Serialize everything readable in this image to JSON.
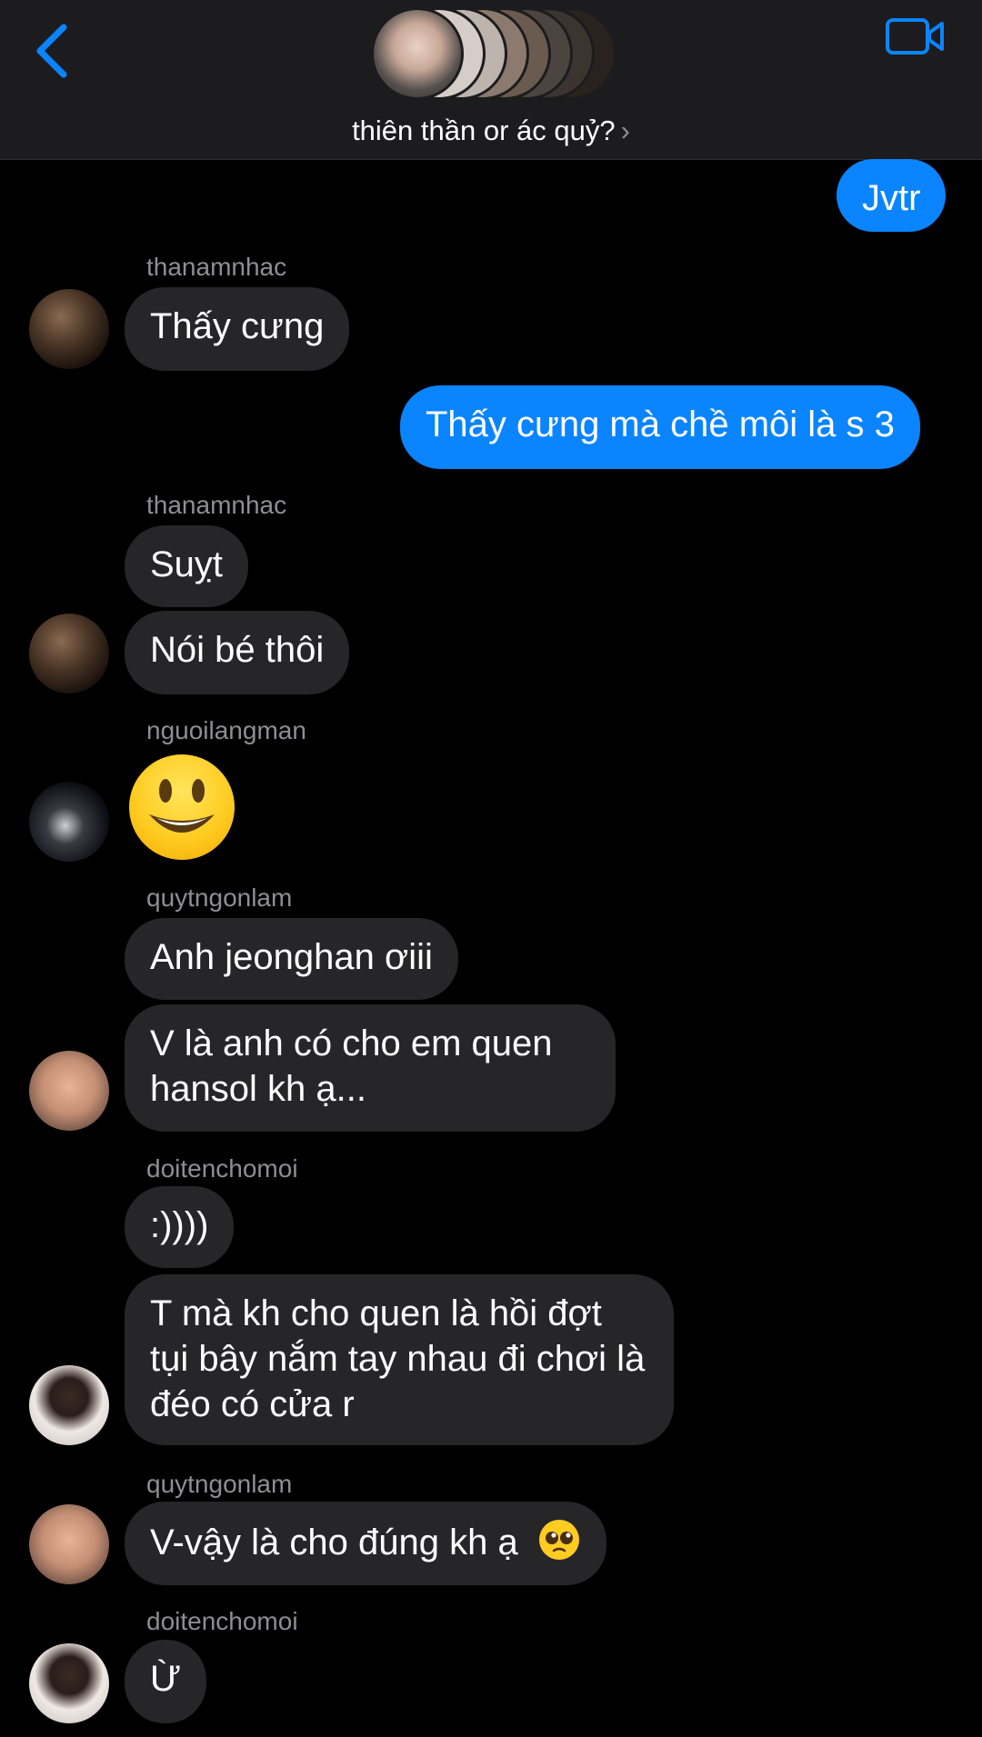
{
  "header": {
    "title": "thiên thần or ác quỷ?",
    "chevron": "›",
    "accent_color": "#0a84ff"
  },
  "messages": {
    "m1": "Jvtr",
    "s1": "thanamnhac",
    "m2": "Thấy cưng",
    "m3": "Thấy cưng mà chề môi là s 3",
    "s2": "thanamnhac",
    "m4": "Suỵt",
    "m5": "Nói bé thôi",
    "s3": "nguoilangman",
    "s4": "quytngonlam",
    "m6": "Anh jeonghan ơiii",
    "m7": "V là anh có cho em quen hansol kh ạ...",
    "s5": "doitenchomoi",
    "m8": ":))))",
    "m9": "T mà kh cho quen là hồi đợt tụi bây nắm tay nhau đi chơi là đéo có cửa r",
    "s6": "quytngonlam",
    "m10": "V-vậy là cho đúng kh ạ",
    "s7": "doitenchomoi",
    "m11": "Ừ"
  },
  "colors": {
    "header_bg": "#1c1c1e",
    "incoming_bubble": "#262628",
    "outgoing_bubble": "#0a84ff",
    "sender_text": "#8e8e93"
  }
}
